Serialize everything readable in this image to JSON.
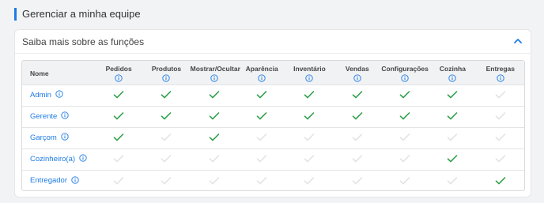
{
  "page_title": "Gerenciar a minha equipe",
  "section": {
    "title": "Saiba mais sobre as funções",
    "expanded": true
  },
  "colors": {
    "accent": "#1e7be5",
    "check_on": "#2fa04a",
    "check_off": "#e3e3e3"
  },
  "table": {
    "name_header": "Nome",
    "columns": [
      "Pedidos",
      "Produtos",
      "Mostrar/Ocultar",
      "Aparência",
      "Inventário",
      "Vendas",
      "Configurações",
      "Cozinha",
      "Entregas"
    ],
    "rows": [
      {
        "name": "Admin",
        "perms": [
          true,
          true,
          true,
          true,
          true,
          true,
          true,
          true,
          false
        ]
      },
      {
        "name": "Gerente",
        "perms": [
          true,
          true,
          true,
          true,
          true,
          true,
          true,
          true,
          false
        ]
      },
      {
        "name": "Garçom",
        "perms": [
          true,
          false,
          true,
          false,
          false,
          false,
          false,
          false,
          false
        ]
      },
      {
        "name": "Cozinheiro(a)",
        "perms": [
          false,
          false,
          false,
          false,
          false,
          false,
          false,
          true,
          false
        ]
      },
      {
        "name": "Entregador",
        "perms": [
          false,
          false,
          false,
          false,
          false,
          false,
          false,
          false,
          true
        ]
      }
    ]
  }
}
